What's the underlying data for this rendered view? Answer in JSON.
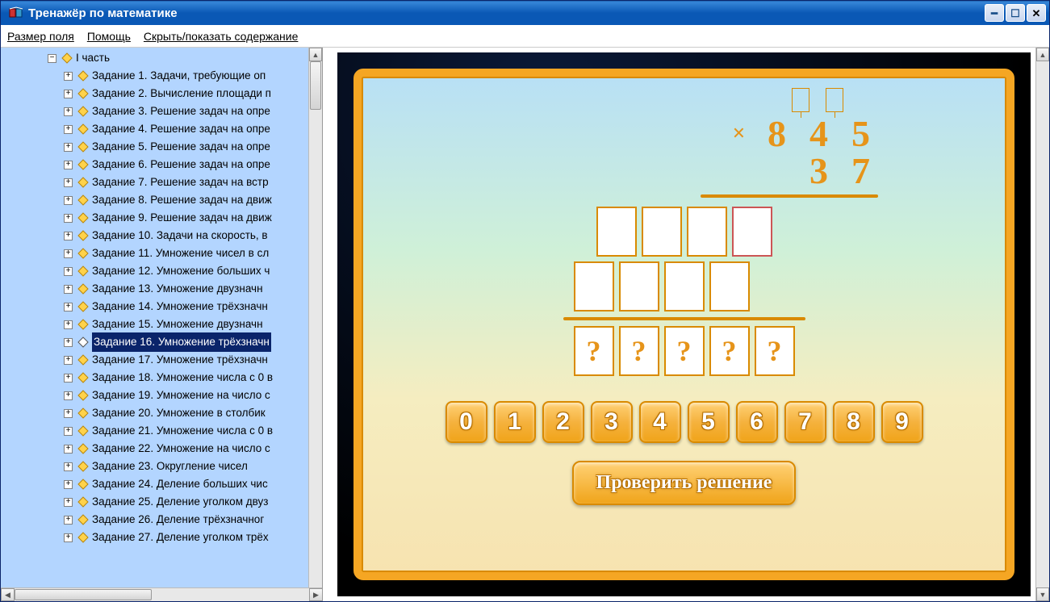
{
  "window": {
    "title": "Тренажёр по математике"
  },
  "menu": {
    "field_size": "Размер поля",
    "help": "Помощь",
    "toggle_toc": "Скрыть/показать содержание"
  },
  "tree": {
    "root": "I часть",
    "selected_index": 15,
    "items": [
      "Задание 1. Задачи, требующие оп",
      "Задание 2. Вычисление площади п",
      "Задание 3. Решение задач на опре",
      "Задание 4. Решение задач на опре",
      "Задание 5. Решение задач на опре",
      "Задание 6. Решение задач на опре",
      "Задание 7. Решение задач на встр",
      "Задание 8. Решение задач на движ",
      "Задание 9. Решение задач на движ",
      "Задание 10. Задачи на скорость, в",
      "Задание 11. Умножение чисел в сл",
      "Задание 12. Умножение больших ч",
      "Задание 13. Умножение двузначн",
      "Задание 14. Умножение трёхзначн",
      "Задание 15. Умножение двузначн",
      "Задание 16. Умножение трёхзначн",
      "Задание 17. Умножение трёхзначн",
      "Задание 18. Умножение числа с 0 в",
      "Задание 19. Умножение на число с",
      "Задание 20. Умножение в столбик",
      "Задание 21. Умножение числа с 0 в",
      "Задание 22. Умножение на число с",
      "Задание 23. Округление чисел",
      "Задание 24. Деление больших чис",
      "Задание 25. Деление уголком двуз",
      "Задание 26. Деление трёхзначног",
      "Задание 27. Деление уголком трёх"
    ]
  },
  "exercise": {
    "multiplicand": [
      "8",
      "4",
      "5"
    ],
    "multiplier": [
      "3",
      "7"
    ],
    "mult_sign": "×",
    "result_placeholder": "?",
    "keypad": [
      "0",
      "1",
      "2",
      "3",
      "4",
      "5",
      "6",
      "7",
      "8",
      "9"
    ],
    "check_button": "Проверить решение"
  }
}
